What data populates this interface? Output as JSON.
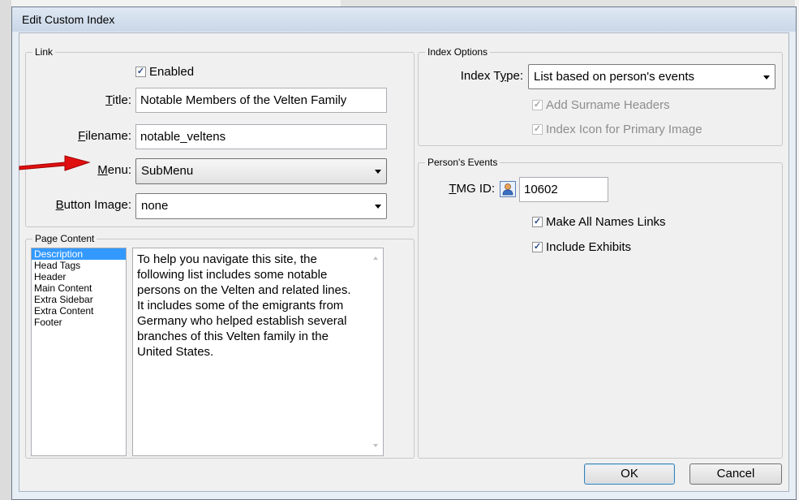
{
  "dialog": {
    "title": "Edit Custom Index"
  },
  "link": {
    "group_title": "Link",
    "enabled_label": "Enabled",
    "title_label": "Title:",
    "title_value": "Notable Members of the Velten Family",
    "filename_label": "Filename:",
    "filename_value": "notable_veltens",
    "menu_label": "Menu:",
    "menu_value": "SubMenu",
    "button_image_label": "Button Image:",
    "button_image_value": "none"
  },
  "index_options": {
    "group_title": "Index Options",
    "index_type_label": "Index Type:",
    "index_type_value": "List based on person's events",
    "add_surname_headers": "Add Surname Headers",
    "index_icon": "Index Icon for Primary Image"
  },
  "persons_events": {
    "group_title": "Person's Events",
    "tmg_id_label": "TMG ID:",
    "tmg_id_value": "10602",
    "make_all_names_links": "Make All Names Links",
    "include_exhibits": "Include Exhibits"
  },
  "page_content": {
    "group_title": "Page Content",
    "items": [
      "Description",
      "Head Tags",
      "Header",
      "Main Content",
      "Extra Sidebar",
      "Extra Content",
      "Footer"
    ],
    "selected": "Description",
    "text": "To help you navigate this site, the following list includes some notable persons on the Velten and related lines. It includes some of the emigrants from Germany who helped establish several branches of this Velten family in the United States."
  },
  "buttons": {
    "ok": "OK",
    "cancel": "Cancel"
  },
  "colors": {
    "arrow": "#e01010",
    "selection": "#3399ff"
  }
}
